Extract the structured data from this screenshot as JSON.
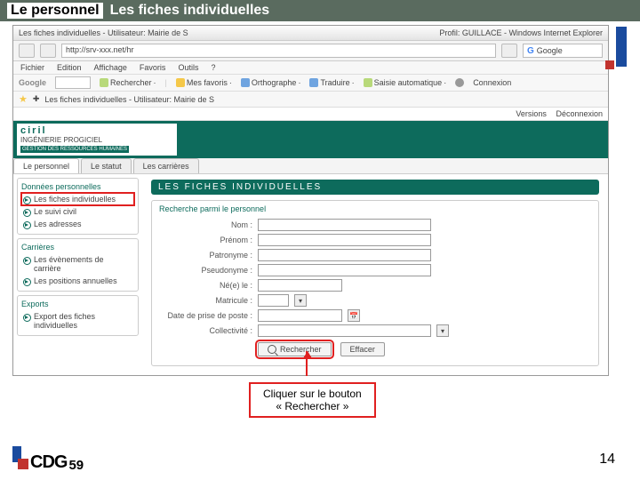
{
  "slide": {
    "title_prefix": "Le personnel",
    "title": "Les fiches individuelles",
    "page_number": "14"
  },
  "logo": {
    "text": "CDG",
    "num": "59"
  },
  "browser": {
    "title_left": "Les fiches individuelles - Utilisateur: Mairie de S",
    "title_right": "Profil: GUILLACE - Windows Internet Explorer",
    "address": "http://srv-xxx.net/hr",
    "search_placeholder": "Google",
    "menus": [
      "Fichier",
      "Edition",
      "Affichage",
      "Favoris",
      "Outils",
      "?"
    ],
    "google_toolbar": {
      "label": "Google",
      "search_btn": "Rechercher",
      "favoris": "Mes favoris",
      "ortho": "Orthographe",
      "traduire": "Traduire",
      "saisie": "Saisie automatique",
      "connexion": "Connexion"
    },
    "favbar": "Les fiches individuelles - Utilisateur: Mairie de S",
    "topstrip": {
      "versions": "Versions",
      "deconnexion": "Déconnexion"
    }
  },
  "brand": {
    "name": "ciril",
    "sub": "INGÉNIERIE PROGICIEL",
    "tag": "GESTION DES RESSOURCES HUMAINES"
  },
  "tabs": [
    "Le personnel",
    "Le statut",
    "Les carrières"
  ],
  "sidebar": {
    "group1": {
      "title": "Données personnelles",
      "items": [
        "Les fiches individuelles",
        "Le suivi civil",
        "Les adresses"
      ]
    },
    "group2": {
      "title": "Carrières",
      "items": [
        "Les évènements de carrière",
        "Les positions annuelles"
      ]
    },
    "group3": {
      "title": "Exports",
      "items": [
        "Export des fiches individuelles"
      ]
    }
  },
  "main": {
    "title": "LES FICHES INDIVIDUELLES",
    "panel_head": "Recherche parmi le personnel",
    "fields": {
      "nom": "Nom :",
      "prenom": "Prénom :",
      "patronyme": "Patronyme :",
      "pseudonyme": "Pseudonyme :",
      "nee": "Né(e) le :",
      "matricule": "Matricule :",
      "date_prise": "Date de prise de poste :",
      "collectivite": "Collectivité :"
    },
    "buttons": {
      "rechercher": "Rechercher",
      "effacer": "Effacer"
    }
  },
  "callout": {
    "line1": "Cliquer sur le bouton",
    "line2": "« Rechercher »"
  }
}
